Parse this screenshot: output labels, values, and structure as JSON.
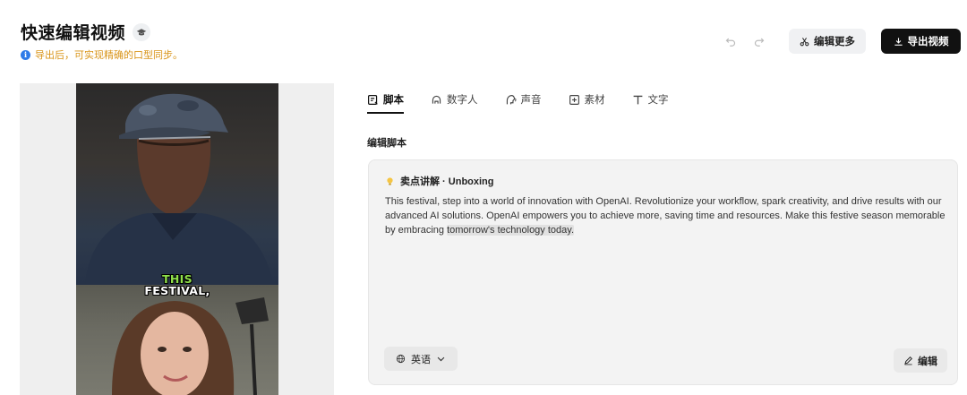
{
  "header": {
    "title": "快速编辑视频",
    "hint": "导出后，可实现精确的口型同步。",
    "more_label": "编辑更多",
    "export_label": "导出视频"
  },
  "preview": {
    "caption_line1": "THIS",
    "caption_line2": "FESTIVAL,"
  },
  "tabs": [
    {
      "label": "脚本",
      "icon": "script-icon",
      "active": true
    },
    {
      "label": "数字人",
      "icon": "avatar-icon",
      "active": false
    },
    {
      "label": "声音",
      "icon": "voice-icon",
      "active": false
    },
    {
      "label": "素材",
      "icon": "material-icon",
      "active": false
    },
    {
      "label": "文字",
      "icon": "text-icon",
      "active": false
    }
  ],
  "editor": {
    "section_label": "编辑脚本",
    "script_title": "卖点讲解 · Unboxing",
    "script_text_main": "This festival, step into a world of innovation with OpenAI. Revolutionize your workflow, spark creativity, and drive results with our advanced AI solutions. OpenAI empowers you to achieve more, saving time and resources. Make this festive season memorable by embracing ",
    "script_text_highlight": "tomorrow's technology today.",
    "language": "英语",
    "edit_label": "编辑"
  },
  "colors": {
    "accent_dark": "#111111",
    "hint_orange": "#d9951a",
    "caption_green": "#8fe04a"
  }
}
